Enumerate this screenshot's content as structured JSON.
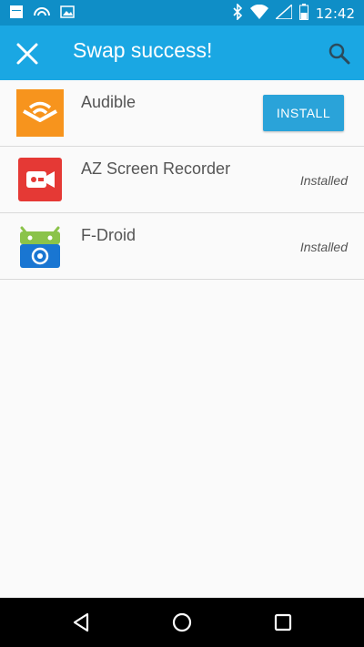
{
  "status_bar": {
    "time": "12:42",
    "icons": [
      "calendar-icon",
      "signal-arc-icon",
      "image-icon",
      "bluetooth-icon",
      "wifi-icon",
      "signal-icon",
      "battery-icon"
    ]
  },
  "app_bar": {
    "title": "Swap success!",
    "close_icon": "close-icon",
    "search_icon": "search-icon",
    "color": "#1aa7e3"
  },
  "apps": [
    {
      "name": "Audible",
      "action_label": "INSTALL",
      "icon": "audible-icon",
      "icon_color": "#f7941d"
    },
    {
      "name": "AZ Screen Recorder",
      "status": "Installed",
      "icon": "az-screen-recorder-icon",
      "icon_color": "#e53935"
    },
    {
      "name": "F-Droid",
      "status": "Installed",
      "icon": "f-droid-icon",
      "icon_color": "#1976d2"
    }
  ],
  "nav_bar": {
    "icons": [
      "back-icon",
      "home-icon",
      "recents-icon"
    ]
  }
}
